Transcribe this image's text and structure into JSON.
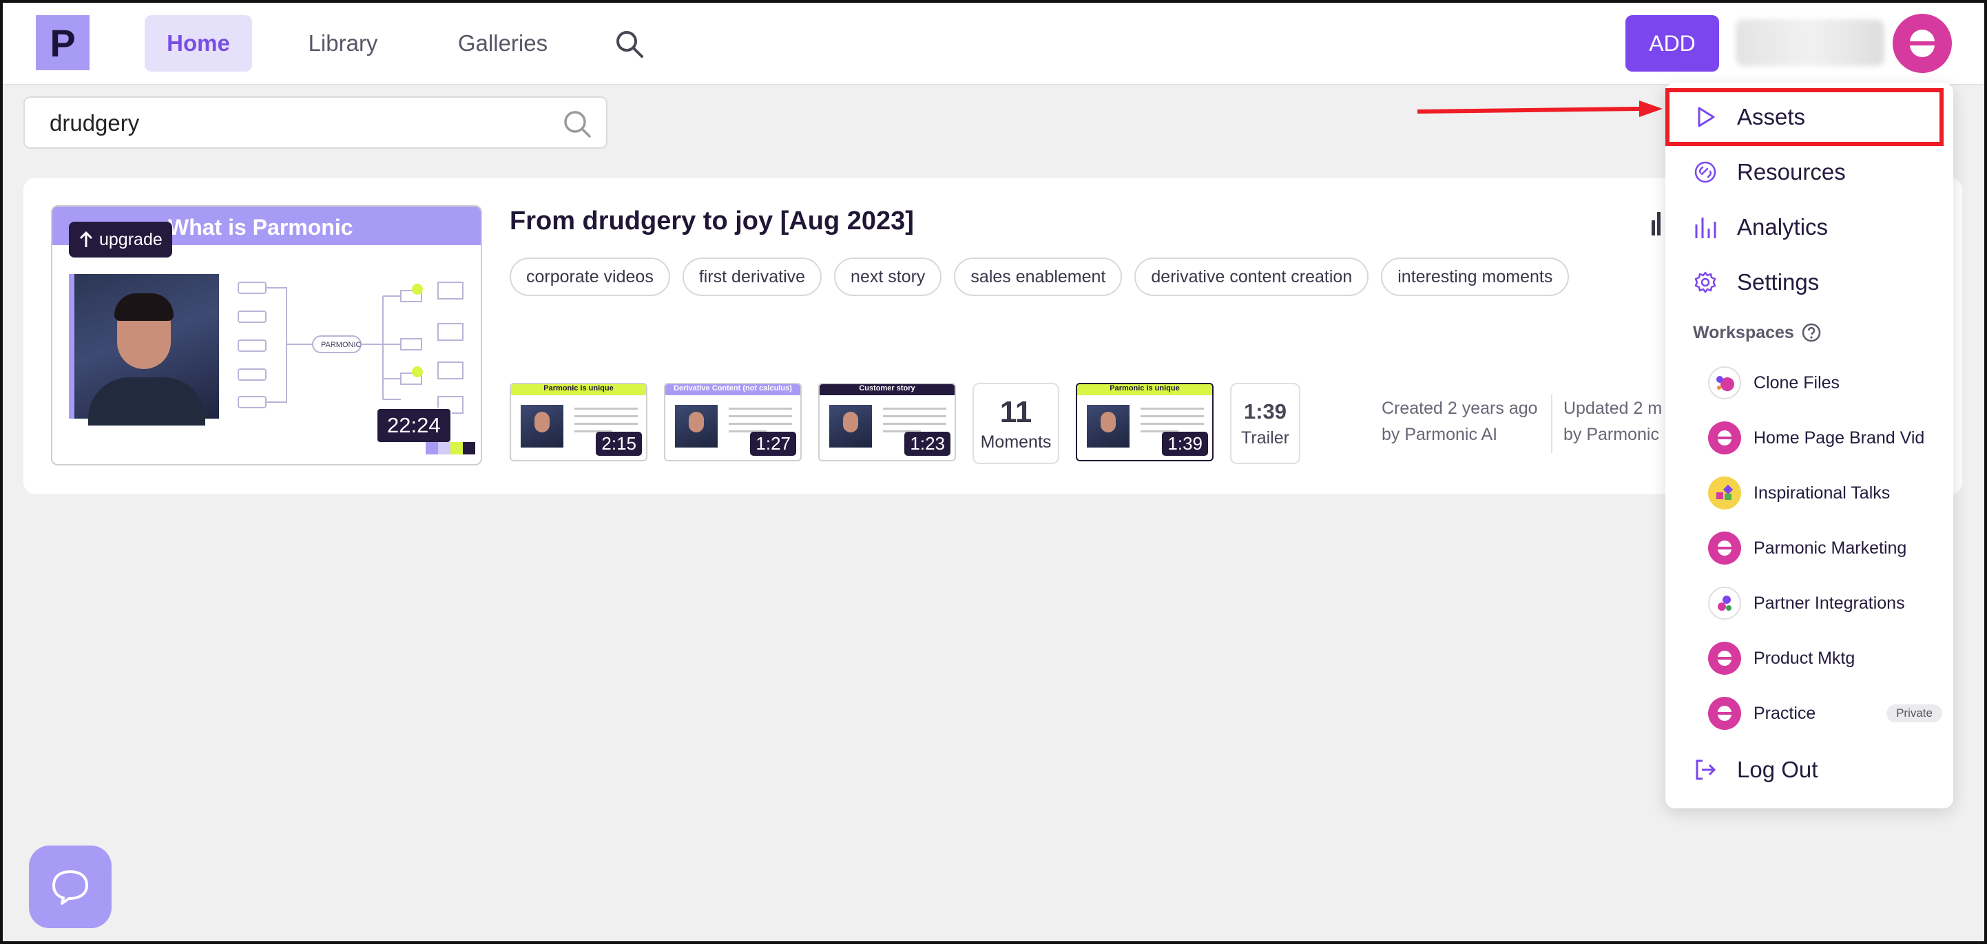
{
  "header": {
    "logo_letter": "P",
    "nav": [
      {
        "label": "Home"
      },
      {
        "label": "Library"
      },
      {
        "label": "Galleries"
      }
    ],
    "add_label": "ADD"
  },
  "search": {
    "value": "drudgery"
  },
  "result": {
    "thumbnail_title": "What is Parmonic",
    "upgrade_label": "upgrade",
    "duration": "22:24",
    "title": "From drudgery to joy [Aug 2023]",
    "tags": [
      "corporate videos",
      "first derivative",
      "next story",
      "sales enablement",
      "derivative content creation",
      "interesting moments"
    ],
    "moments": [
      {
        "heading": "Parmonic is unique",
        "duration": "2:15",
        "accent": "#d9f545"
      },
      {
        "heading": "Derivative Content (not calculus)",
        "duration": "1:27",
        "accent": "#a89bf5"
      },
      {
        "heading": "Customer story",
        "duration": "1:23",
        "accent": "#231a3e"
      }
    ],
    "moments_count": "11",
    "moments_label": "Moments",
    "trailer_thumb": {
      "heading": "Parmonic is unique",
      "duration": "1:39",
      "accent": "#d9f545"
    },
    "trailer_time": "1:39",
    "trailer_label": "Trailer",
    "created_line1": "Created 2 years ago",
    "created_line2": "by Parmonic AI",
    "updated_line1": "Updated 2 m",
    "updated_line2": "by Parmonic"
  },
  "menu": {
    "items": [
      {
        "label": "Assets",
        "icon": "play-icon"
      },
      {
        "label": "Resources",
        "icon": "link-icon"
      },
      {
        "label": "Analytics",
        "icon": "bar-chart-icon"
      },
      {
        "label": "Settings",
        "icon": "gear-icon"
      }
    ],
    "workspaces_heading": "Workspaces",
    "workspaces": [
      {
        "label": "Clone Files",
        "avatar": "ring"
      },
      {
        "label": "Home Page Brand Vid",
        "avatar": "pink"
      },
      {
        "label": "Inspirational Talks",
        "avatar": "yellow"
      },
      {
        "label": "Parmonic Marketing",
        "avatar": "pink"
      },
      {
        "label": "Partner Integrations",
        "avatar": "ring"
      },
      {
        "label": "Product Mktg",
        "avatar": "pink"
      },
      {
        "label": "Practice",
        "avatar": "pink",
        "badge": "Private"
      }
    ],
    "logout_label": "Log Out"
  },
  "colors": {
    "brand_purple": "#7b46ee",
    "lavender": "#a89bf5",
    "pink": "#d63a9e",
    "annotation_red": "#ee1c24"
  }
}
